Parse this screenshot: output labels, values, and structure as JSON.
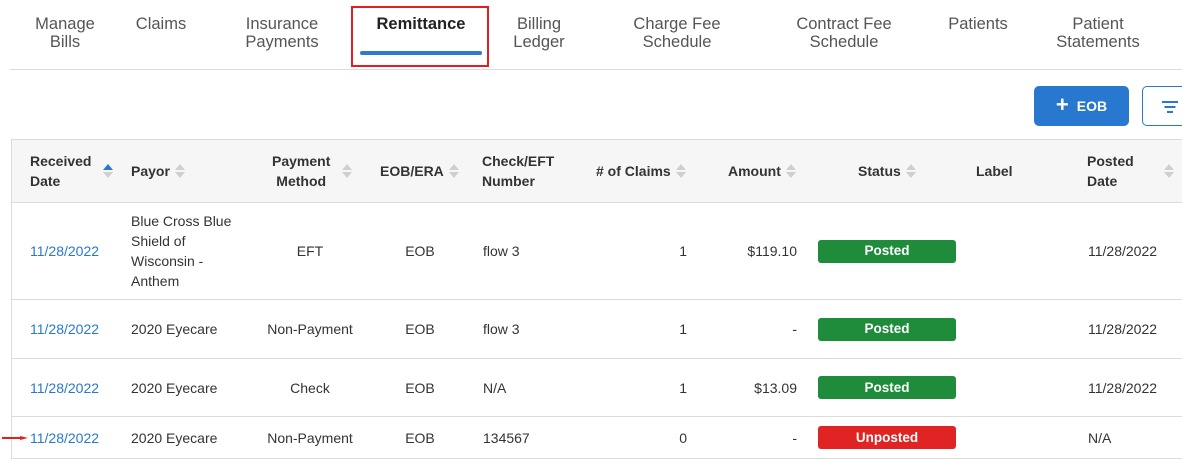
{
  "nav": {
    "tabs": [
      {
        "line1": "Manage",
        "line2": "Bills"
      },
      {
        "line1": "Claims",
        "line2": ""
      },
      {
        "line1": "Insurance",
        "line2": "Payments"
      },
      {
        "line1": "Remittance",
        "line2": ""
      },
      {
        "line1": "Billing",
        "line2": "Ledger"
      },
      {
        "line1": "Charge Fee",
        "line2": "Schedule"
      },
      {
        "line1": "Contract Fee",
        "line2": "Schedule"
      },
      {
        "line1": "Patients",
        "line2": ""
      },
      {
        "line1": "Patient",
        "line2": "Statements"
      }
    ],
    "active_tab": "Remittance"
  },
  "toolbar": {
    "add_eob_label": "EOB",
    "plus_icon": "plus-icon",
    "filter_icon": "filter-icon"
  },
  "table": {
    "columns": [
      {
        "line1": "Received",
        "line2": "Date"
      },
      {
        "line1": "Payor",
        "line2": ""
      },
      {
        "line1": "Payment",
        "line2": "Method"
      },
      {
        "line1": "EOB/ERA",
        "line2": ""
      },
      {
        "line1": "Check/EFT",
        "line2": "Number"
      },
      {
        "line1": "# of Claims",
        "line2": ""
      },
      {
        "line1": "Amount",
        "line2": ""
      },
      {
        "line1": "Status",
        "line2": ""
      },
      {
        "line1": "Label",
        "line2": ""
      },
      {
        "line1": "Posted",
        "line2": "Date"
      }
    ],
    "rows": [
      {
        "received_date": "11/28/2022",
        "payor": "Blue Cross Blue Shield of Wisconsin - Anthem",
        "payment_method": "EFT",
        "eob_era": "EOB",
        "check_number": "flow 3",
        "claims": "1",
        "amount": "$119.10",
        "status": "Posted",
        "label": "",
        "posted_date": "11/28/2022"
      },
      {
        "received_date": "11/28/2022",
        "payor": "2020 Eyecare",
        "payment_method": "Non-Payment",
        "eob_era": "EOB",
        "check_number": "flow 3",
        "claims": "1",
        "amount": "-",
        "status": "Posted",
        "label": "",
        "posted_date": "11/28/2022"
      },
      {
        "received_date": "11/28/2022",
        "payor": "2020 Eyecare",
        "payment_method": "Check",
        "eob_era": "EOB",
        "check_number": "N/A",
        "claims": "1",
        "amount": "$13.09",
        "status": "Posted",
        "label": "",
        "posted_date": "11/28/2022"
      },
      {
        "received_date": "11/28/2022",
        "payor": "2020 Eyecare",
        "payment_method": "Non-Payment",
        "eob_era": "EOB",
        "check_number": "134567",
        "claims": "0",
        "amount": "-",
        "status": "Unposted",
        "label": "",
        "posted_date": "N/A"
      }
    ]
  },
  "colors": {
    "accent": "#2878cf",
    "posted": "#1e8c3a",
    "unposted": "#e02424",
    "highlight": "#e02020"
  }
}
